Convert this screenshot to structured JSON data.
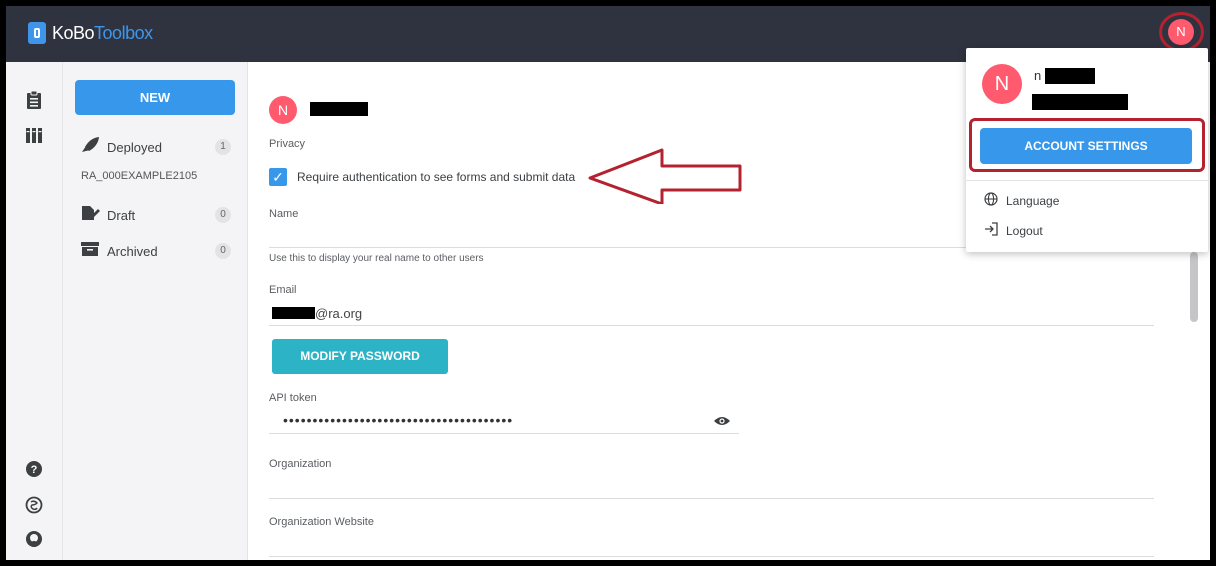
{
  "header": {
    "logo_primary": "KoBo",
    "logo_secondary": "Toolbox",
    "avatar_letter": "N"
  },
  "iconbar": {
    "icons": [
      "clipboard-icon",
      "library-icon",
      "help-icon",
      "community-icon",
      "github-icon"
    ]
  },
  "sidebar": {
    "new_label": "NEW",
    "items": [
      {
        "label": "Deployed",
        "count": "1",
        "icon": "rocket-icon"
      },
      {
        "label": "Draft",
        "count": "0",
        "icon": "pen-icon"
      },
      {
        "label": "Archived",
        "count": "0",
        "icon": "archive-icon"
      }
    ],
    "deployed_sub": "RA_000EXAMPLE2105"
  },
  "main": {
    "avatar_letter": "N",
    "privacy_label": "Privacy",
    "privacy_checkbox_label": "Require authentication to see forms and submit data",
    "privacy_checked": true,
    "name_label": "Name",
    "name_hint": "Use this to display your real name to other users",
    "email_label": "Email",
    "email_domain": "@ra.org",
    "modify_password_label": "MODIFY PASSWORD",
    "api_token_label": "API token",
    "api_token_value": "•••••••••••••••••••••••••••••••••••••••",
    "organization_label": "Organization",
    "organization_website_label": "Organization Website"
  },
  "dropdown": {
    "avatar_letter": "N",
    "name_initial": "n",
    "account_settings_label": "ACCOUNT SETTINGS",
    "language_label": "Language",
    "logout_label": "Logout"
  },
  "colors": {
    "topbar": "#2f3340",
    "accent_blue": "#3797eb",
    "teal": "#2cb3c5",
    "avatar_pink": "#ff5a6e",
    "annotation_red": "#b3222e"
  }
}
